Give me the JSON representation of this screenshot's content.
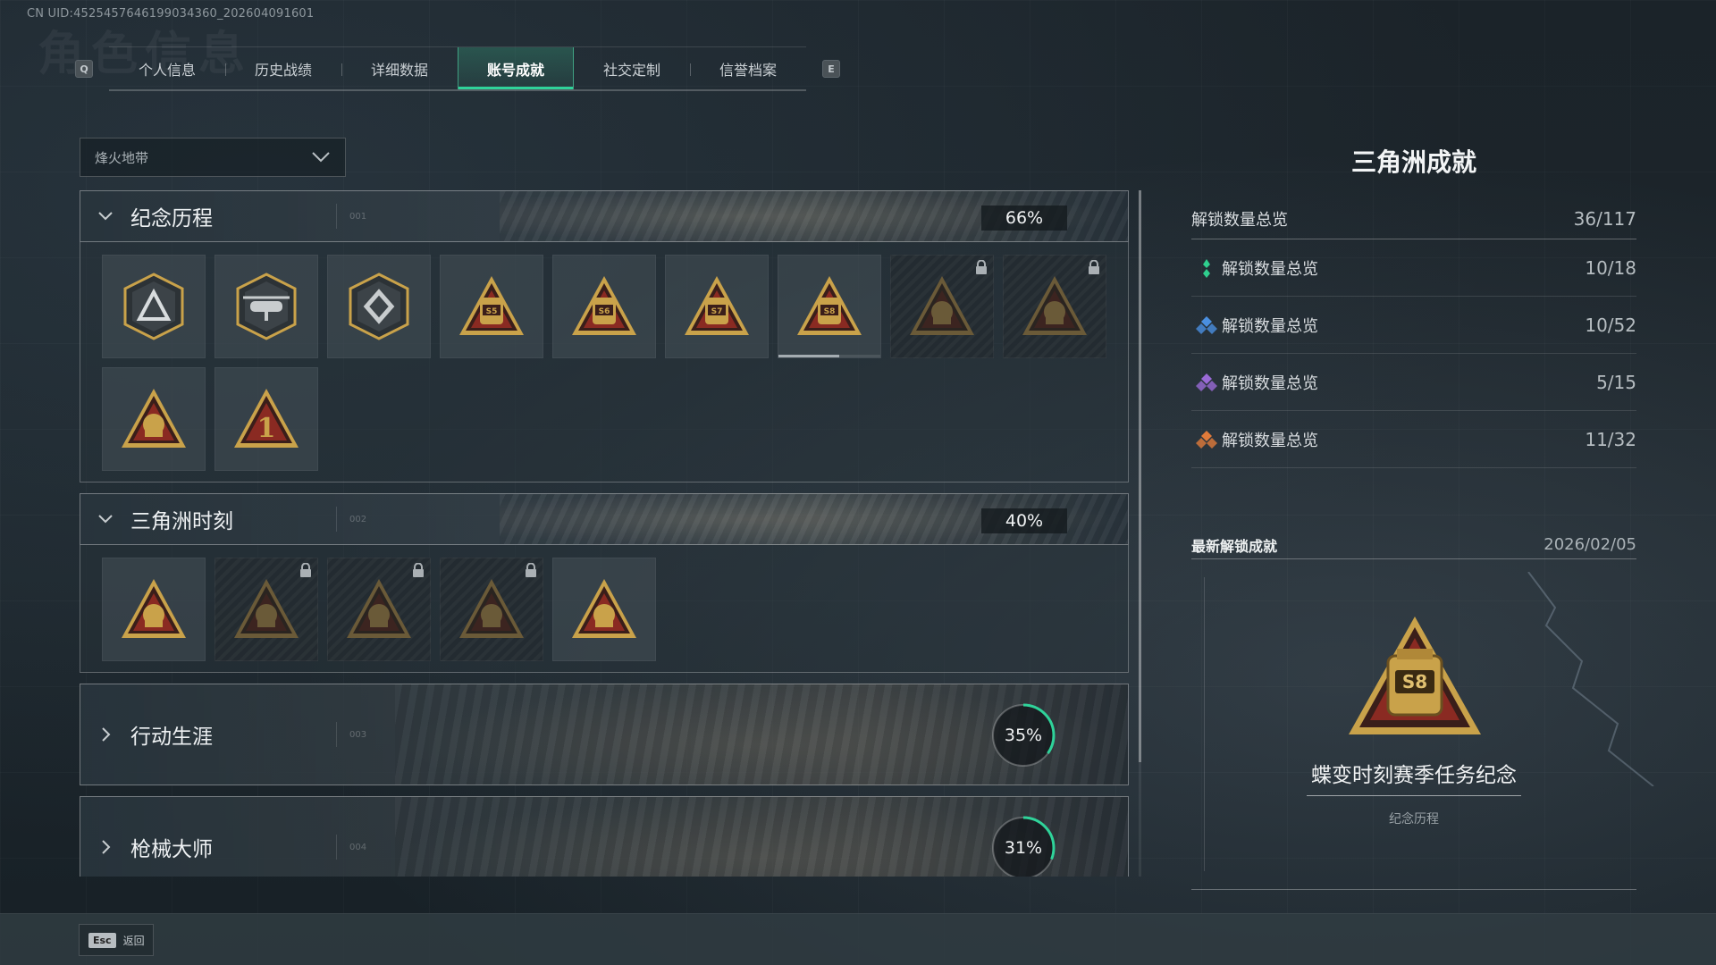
{
  "uid_text": "CN UID:4525457646199034360_202604091601",
  "watermark_title": "角色信息",
  "tabs": {
    "prev_key": "Q",
    "next_key": "E",
    "items": [
      {
        "label": "个人信息"
      },
      {
        "label": "历史战绩"
      },
      {
        "label": "详细数据"
      },
      {
        "label": "账号成就"
      },
      {
        "label": "社交定制"
      },
      {
        "label": "信誉档案"
      }
    ],
    "active_index": 3
  },
  "mode_select": {
    "value": "烽火地带"
  },
  "sections": [
    {
      "title": "纪念历程",
      "number": "001",
      "percent": "66%",
      "expanded": true,
      "badges": [
        {
          "icon": "triangle-shield-badge-icon",
          "locked": false
        },
        {
          "icon": "helicopter-badge-icon",
          "locked": false
        },
        {
          "icon": "diamond-shield-badge-icon",
          "locked": false
        },
        {
          "icon": "s5-season-badge-icon",
          "locked": false
        },
        {
          "icon": "s6-season-badge-icon",
          "locked": false
        },
        {
          "icon": "s7-season-badge-icon",
          "locked": false
        },
        {
          "icon": "s8-season-badge-icon",
          "locked": false,
          "progress": 0.6
        },
        {
          "icon": "mask-badge-icon",
          "locked": true
        },
        {
          "icon": "crossed-rifles-badge-icon",
          "locked": true
        },
        {
          "icon": "ship-badge-icon",
          "locked": false
        },
        {
          "icon": "number-one-badge-icon",
          "locked": false
        }
      ]
    },
    {
      "title": "三角洲时刻",
      "number": "002",
      "percent": "40%",
      "expanded": true,
      "badges": [
        {
          "icon": "bottle-badge-icon",
          "locked": false
        },
        {
          "icon": "skull-badge-icon",
          "locked": true
        },
        {
          "icon": "runner-badge-icon",
          "locked": true
        },
        {
          "icon": "eye-badge-icon",
          "locked": true
        },
        {
          "icon": "squad-badge-icon",
          "locked": false
        }
      ]
    }
  ],
  "collapsed_sections": [
    {
      "title": "行动生涯",
      "number": "003",
      "percent": "35%",
      "progress": 0.35
    },
    {
      "title": "枪械大师",
      "number": "004",
      "percent": "31%",
      "progress": 0.31
    }
  ],
  "right_panel": {
    "title": "三角洲成就",
    "total": {
      "label": "解锁数量总览",
      "value": "36/117"
    },
    "rows": [
      {
        "label": "解锁数量总览",
        "value": "10/18",
        "gem_color": "#2fcf8e",
        "gem": "green-gem-icon"
      },
      {
        "label": "解锁数量总览",
        "value": "10/52",
        "gem_color": "#4a8fe0",
        "gem": "blue-gem-icon"
      },
      {
        "label": "解锁数量总览",
        "value": "5/15",
        "gem_color": "#9a6ad6",
        "gem": "purple-gem-icon"
      },
      {
        "label": "解锁数量总览",
        "value": "11/32",
        "gem_color": "#e07a3a",
        "gem": "orange-gem-icon"
      }
    ],
    "latest": {
      "label": "最新解锁成就",
      "date": "2026/02/05",
      "name": "蝶变时刻赛季任务纪念",
      "category": "纪念历程",
      "badge_text": "S8"
    }
  },
  "footer": {
    "esc_key": "Esc",
    "back_label": "返回"
  },
  "colors": {
    "accent": "#2fd39a",
    "gold": "#c9a24a",
    "red": "#8a2a22"
  }
}
